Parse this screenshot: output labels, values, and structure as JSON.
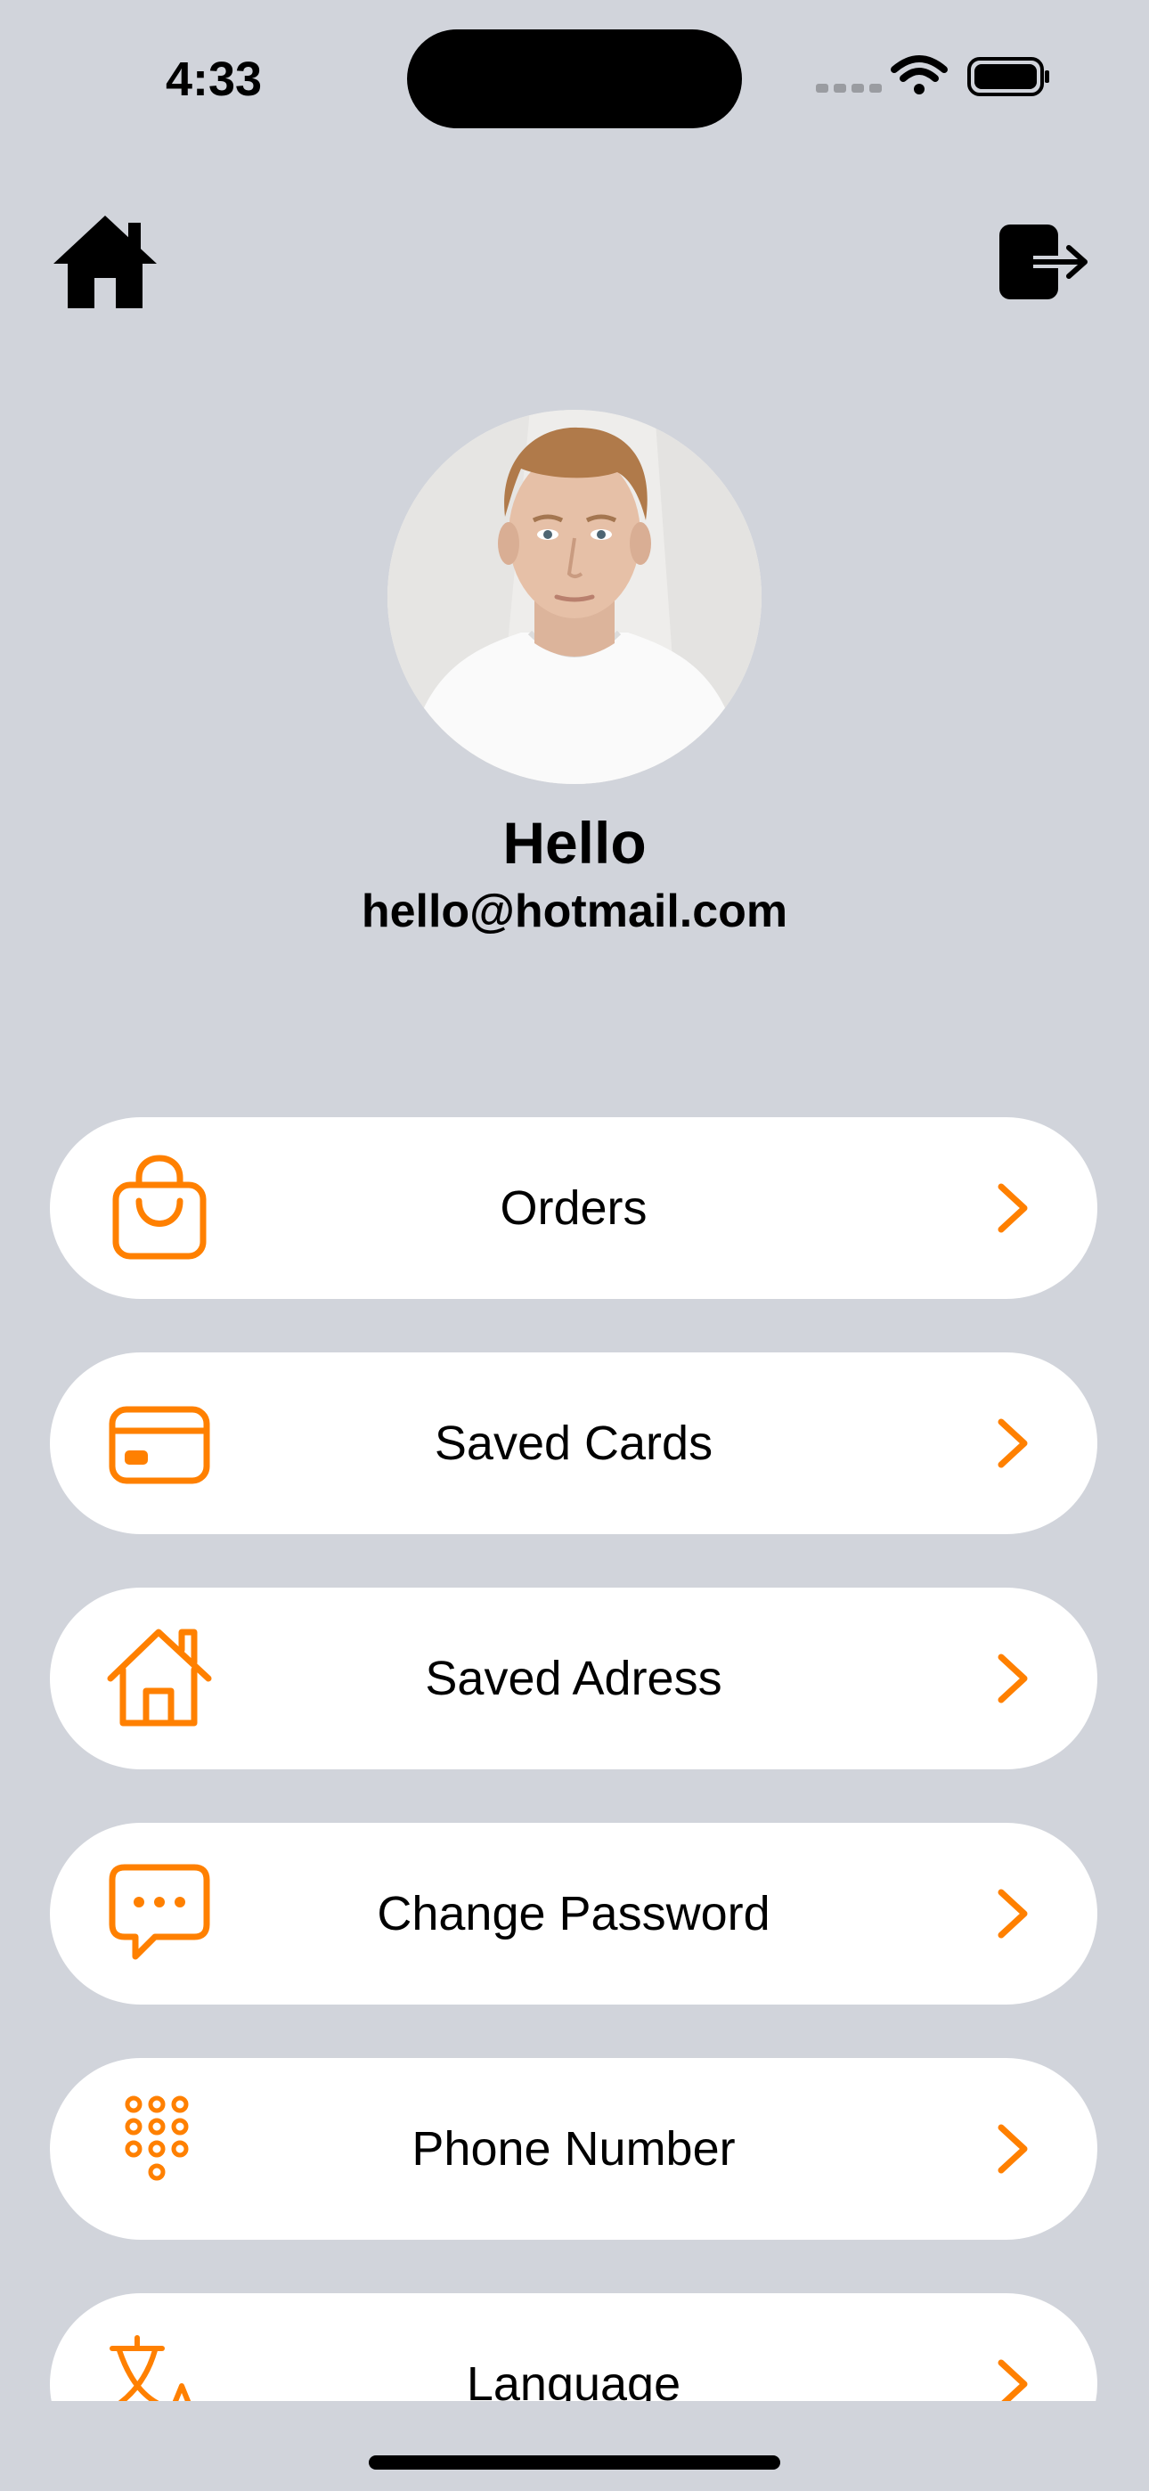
{
  "status_bar": {
    "time": "4:33"
  },
  "profile": {
    "name": "Hello",
    "email": "hello@hotmail.com"
  },
  "icons": {
    "top_left": "home-icon",
    "top_right": "logout-icon"
  },
  "menu": {
    "items": [
      {
        "label": "Orders",
        "icon": "shopping-bag-icon"
      },
      {
        "label": "Saved Cards",
        "icon": "credit-card-icon"
      },
      {
        "label": "Saved Adress",
        "icon": "house-icon"
      },
      {
        "label": "Change Password",
        "icon": "chat-bubble-icon"
      },
      {
        "label": "Phone Number",
        "icon": "keypad-icon"
      },
      {
        "label": "Language",
        "icon": "translate-icon"
      }
    ]
  },
  "colors": {
    "background": "#d1d4db",
    "accent": "#ff8000",
    "row_background": "#ffffff"
  }
}
